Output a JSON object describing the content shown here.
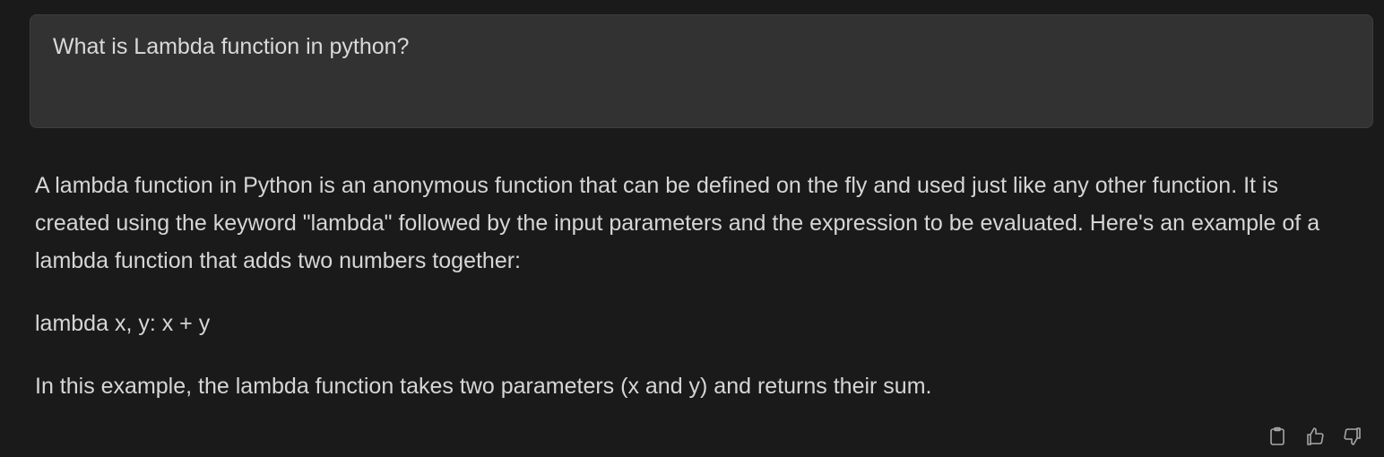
{
  "prompt": {
    "text": "What is Lambda function in python?"
  },
  "response": {
    "paragraph_1": "A lambda function in Python is an anonymous function that can be defined on the fly and used just like any other function. It is created using the keyword \"lambda\" followed by the input parameters and the expression to be evaluated. Here's an example of a lambda function that adds two numbers together:",
    "code_line": "lambda x, y: x + y",
    "paragraph_2": "In this example, the lambda function takes two parameters (x and y) and returns their sum."
  },
  "actions": {
    "icons": [
      "clipboard-icon",
      "thumbs-up-icon",
      "thumbs-down-icon"
    ]
  },
  "colors": {
    "background": "#1a1a1a",
    "prompt_box": "#323232",
    "text": "#d6d6d6",
    "icon": "#a7a7a7"
  }
}
